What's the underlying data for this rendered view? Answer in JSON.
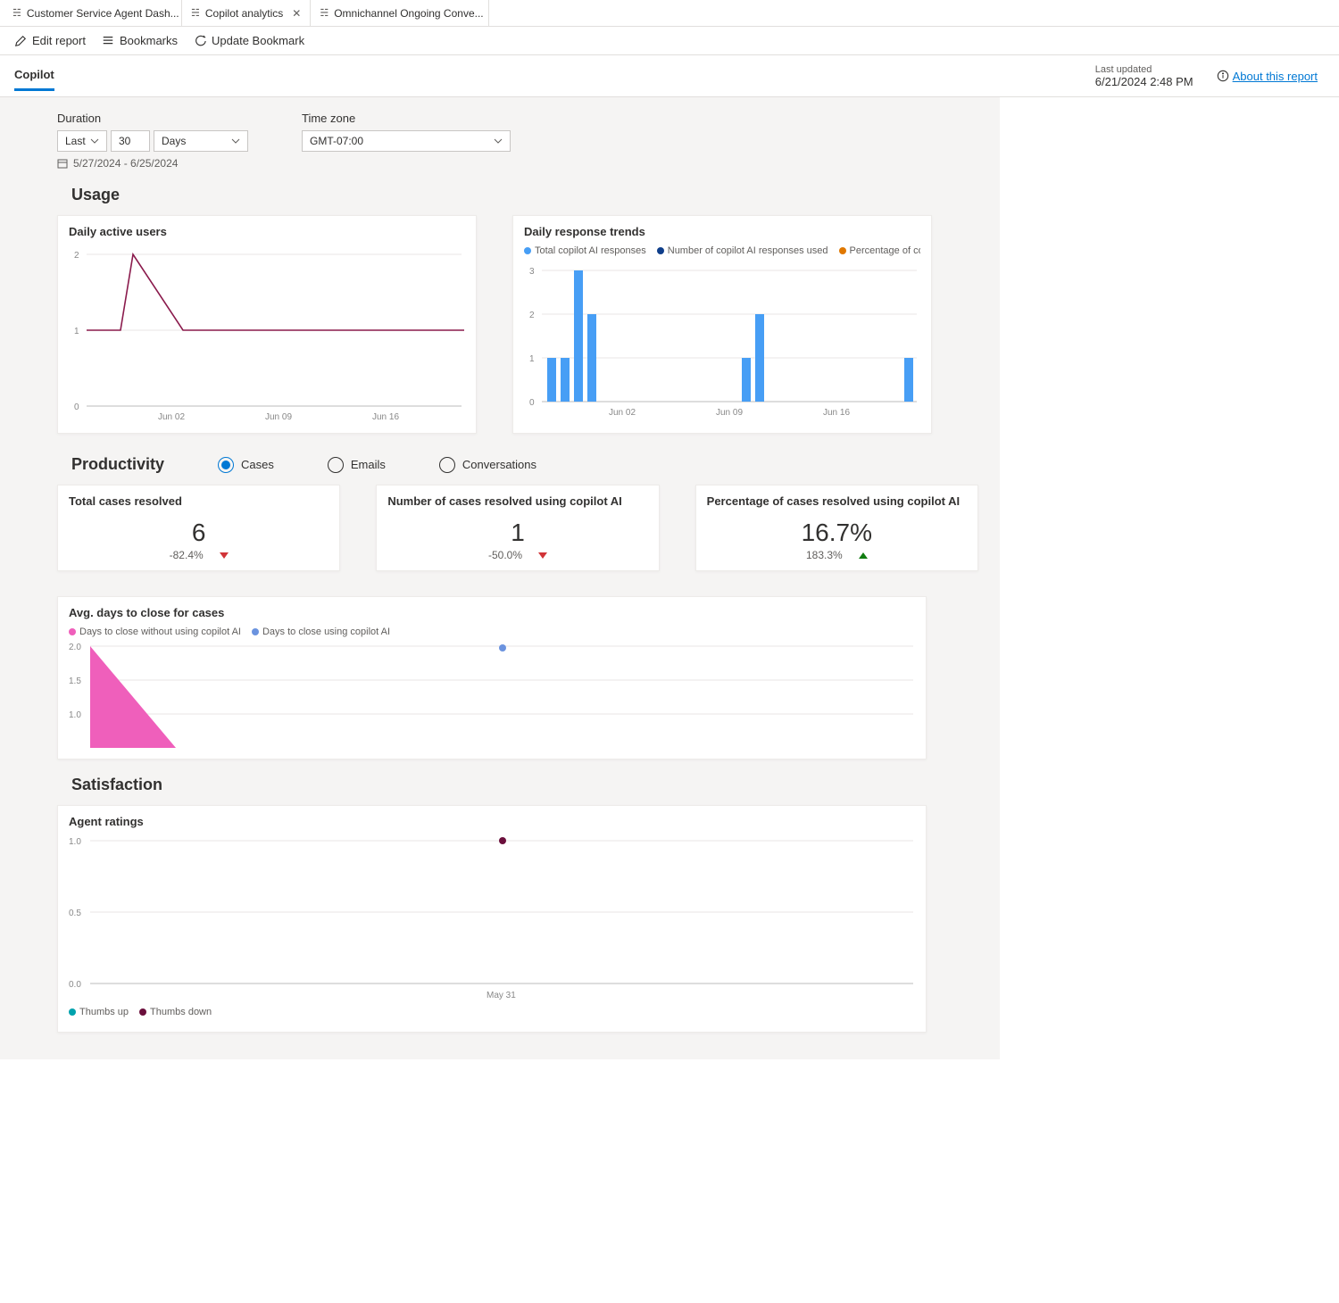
{
  "tabs": {
    "items": [
      {
        "label": "Customer Service Agent Dash..."
      },
      {
        "label": "Copilot analytics",
        "active": true
      },
      {
        "label": "Omnichannel Ongoing Conve..."
      }
    ]
  },
  "toolbar": {
    "edit": "Edit report",
    "bookmarks": "Bookmarks",
    "update_bookmark": "Update Bookmark"
  },
  "report_tab": "Copilot",
  "last_updated": {
    "label": "Last updated",
    "value": "6/21/2024 2:48 PM"
  },
  "about_link": "About this report",
  "filters": {
    "duration_label": "Duration",
    "duration_mode": "Last",
    "duration_value": "30",
    "duration_unit": "Days",
    "date_range": "5/27/2024 - 6/25/2024",
    "timezone_label": "Time zone",
    "timezone_value": "GMT-07:00"
  },
  "usage": {
    "title": "Usage",
    "daily_active": {
      "title": "Daily active users"
    },
    "daily_response": {
      "title": "Daily response trends",
      "legend": [
        {
          "label": "Total copilot AI responses",
          "color": "#479ef5"
        },
        {
          "label": "Number of copilot AI responses used",
          "color": "#0f3e8a"
        },
        {
          "label": "Percentage of copilot AI respo...",
          "color": "#e07800"
        }
      ]
    }
  },
  "productivity": {
    "title": "Productivity",
    "radios": [
      {
        "label": "Cases",
        "selected": true
      },
      {
        "label": "Emails",
        "selected": false
      },
      {
        "label": "Conversations",
        "selected": false
      }
    ],
    "metrics": [
      {
        "title": "Total cases resolved",
        "value": "6",
        "delta": "-82.4%",
        "dir": "down"
      },
      {
        "title": "Number of cases resolved using copilot AI",
        "value": "1",
        "delta": "-50.0%",
        "dir": "down"
      },
      {
        "title": "Percentage of cases resolved using copilot AI",
        "value": "16.7%",
        "delta": "183.3%",
        "dir": "up"
      }
    ],
    "avg_days": {
      "title": "Avg. days to close for cases",
      "legend": [
        {
          "label": "Days to close without using copilot AI",
          "color": "#ef5fbb"
        },
        {
          "label": "Days to close using copilot AI",
          "color": "#6b93df"
        }
      ]
    }
  },
  "satisfaction": {
    "title": "Satisfaction",
    "agent_ratings": {
      "title": "Agent ratings",
      "legend": [
        {
          "label": "Thumbs up",
          "color": "#00a2ad"
        },
        {
          "label": "Thumbs down",
          "color": "#6b0f3c"
        }
      ],
      "xlabel": "May 31"
    }
  },
  "chart_data": [
    {
      "name": "daily_active_users",
      "type": "line",
      "x_ticks": [
        "Jun 02",
        "Jun 09",
        "Jun 16"
      ],
      "ylim": [
        1,
        2
      ],
      "y_ticks": [
        0,
        1,
        2
      ],
      "series": [
        {
          "name": "Daily active users",
          "color": "#8a1a4c",
          "values": [
            1,
            1,
            2,
            1,
            1,
            1,
            1,
            1,
            1,
            1,
            1,
            1,
            1,
            1,
            1,
            1,
            1,
            1,
            1,
            1,
            1,
            1,
            1,
            1,
            1,
            1,
            1,
            1,
            1,
            1
          ]
        }
      ]
    },
    {
      "name": "daily_response_trends",
      "type": "bar",
      "x_ticks": [
        "Jun 02",
        "Jun 09",
        "Jun 16"
      ],
      "ylim": [
        0,
        3
      ],
      "y_ticks": [
        0,
        1,
        2,
        3
      ],
      "series": [
        {
          "name": "Total copilot AI responses",
          "color": "#479ef5",
          "values": [
            1,
            1,
            3,
            2,
            0,
            0,
            0,
            0,
            0,
            0,
            0,
            0,
            0,
            0,
            0,
            0,
            0,
            0,
            1,
            2,
            0,
            0,
            0,
            0,
            0,
            0,
            0,
            0,
            0,
            1
          ]
        }
      ]
    },
    {
      "name": "avg_days_to_close",
      "type": "area",
      "ylim": [
        0.5,
        2.0
      ],
      "y_ticks": [
        1.0,
        1.5,
        2.0
      ],
      "series": [
        {
          "name": "Days to close without using copilot AI",
          "color": "#ef5fbb",
          "values": [
            2.0,
            0.5
          ]
        },
        {
          "name": "Days to close using copilot AI",
          "color": "#6b93df",
          "values": [
            null,
            null
          ]
        }
      ],
      "point": {
        "series": "Days to close using copilot AI",
        "x_frac": 0.5,
        "y": 2.0
      }
    },
    {
      "name": "agent_ratings",
      "type": "scatter",
      "ylim": [
        0.0,
        1.0
      ],
      "y_ticks": [
        0.0,
        0.5,
        1.0
      ],
      "x_ticks": [
        "May 31"
      ],
      "series": [
        {
          "name": "Thumbs up",
          "color": "#00a2ad",
          "points": []
        },
        {
          "name": "Thumbs down",
          "color": "#6b0f3c",
          "points": [
            {
              "x": "May 31",
              "y": 1.0
            }
          ]
        }
      ]
    }
  ]
}
